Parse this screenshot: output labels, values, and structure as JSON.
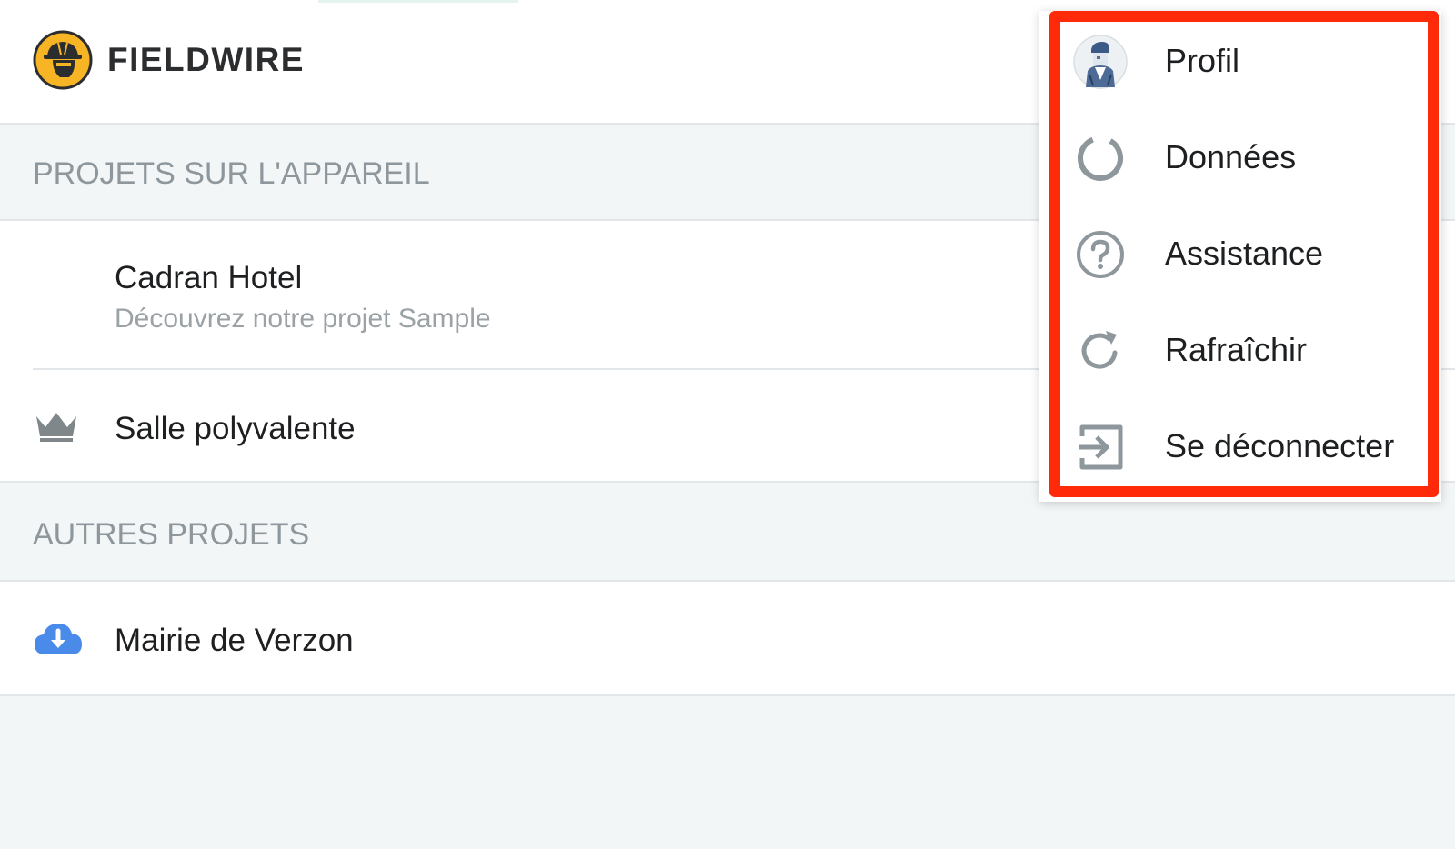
{
  "app": {
    "brand": "FIELDWIRE"
  },
  "sections": {
    "on_device": "PROJETS SUR L'APPAREIL",
    "other": "AUTRES PROJETS"
  },
  "projects": {
    "cadran": {
      "title": "Cadran Hotel",
      "subtitle": "Découvrez notre projet Sample"
    },
    "salle": {
      "title": "Salle polyvalente",
      "icon": "crown-icon"
    },
    "mairie": {
      "title": "Mairie de Verzon",
      "icon": "cloud-download-icon"
    }
  },
  "menu": {
    "items": [
      {
        "label": "Profil",
        "icon": "avatar"
      },
      {
        "label": "Données",
        "icon": "donut-icon"
      },
      {
        "label": "Assistance",
        "icon": "help-circle-icon"
      },
      {
        "label": "Rafraîchir",
        "icon": "refresh-icon"
      },
      {
        "label": "Se déconnecter",
        "icon": "logout-icon"
      }
    ]
  },
  "colors": {
    "brand_yellow": "#f7b526",
    "highlight": "#ff2a0a",
    "cloud_blue": "#4a8ae8",
    "muted_text": "#8e979c",
    "icon_gray": "#9aa2a6"
  }
}
